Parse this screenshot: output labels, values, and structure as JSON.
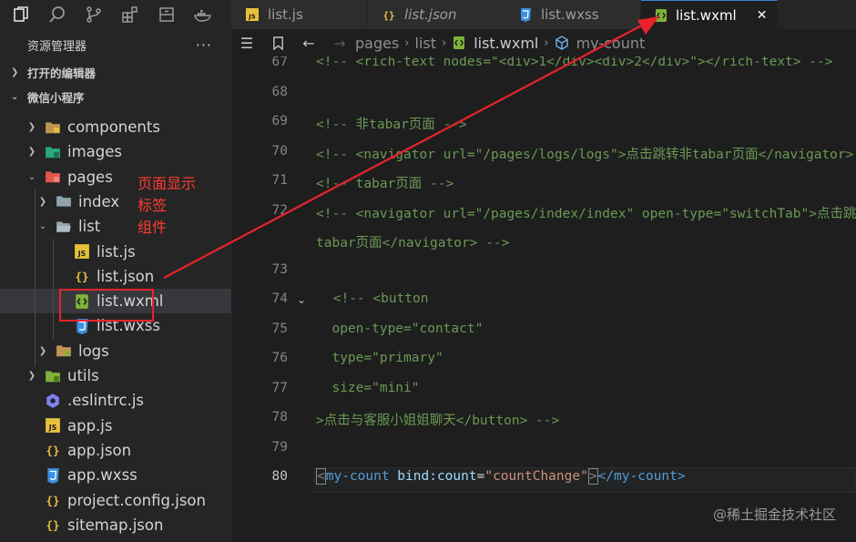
{
  "activity_bar": {
    "icons": [
      "explorer-icon",
      "search-icon",
      "source-control-icon",
      "extensions-icon",
      "storage-icon",
      "docker-icon"
    ]
  },
  "sidebar": {
    "title": "资源管理器",
    "more": "···",
    "sections": [
      {
        "label": "打开的编辑器",
        "expanded": false
      },
      {
        "label": "微信小程序",
        "expanded": true
      }
    ],
    "tree": [
      {
        "label": "components",
        "icon": "components-folder-icon",
        "kind": "folder",
        "chev": "›"
      },
      {
        "label": "images",
        "icon": "images-folder-icon",
        "kind": "folder",
        "chev": "›"
      },
      {
        "label": "pages",
        "icon": "pages-folder-icon",
        "kind": "folder",
        "chev": "⌄"
      },
      {
        "label": "index",
        "icon": "folder-icon",
        "kind": "folder",
        "chev": "›"
      },
      {
        "label": "list",
        "icon": "folder-open-icon",
        "kind": "folder",
        "chev": "⌄"
      },
      {
        "label": "list.js",
        "icon": "js-file-icon",
        "kind": "file"
      },
      {
        "label": "list.json",
        "icon": "json-file-icon",
        "kind": "file"
      },
      {
        "label": "list.wxml",
        "icon": "wxml-file-icon",
        "kind": "file",
        "selected": true
      },
      {
        "label": "list.wxss",
        "icon": "css-file-icon",
        "kind": "file"
      },
      {
        "label": "logs",
        "icon": "logs-folder-icon",
        "kind": "folder",
        "chev": "›"
      },
      {
        "label": "utils",
        "icon": "utils-folder-icon",
        "kind": "folder",
        "chev": "›"
      },
      {
        "label": ".eslintrc.js",
        "icon": "eslint-file-icon",
        "kind": "file"
      },
      {
        "label": "app.js",
        "icon": "js-file-icon",
        "kind": "file"
      },
      {
        "label": "app.json",
        "icon": "json-file-icon",
        "kind": "file"
      },
      {
        "label": "app.wxss",
        "icon": "css-file-icon",
        "kind": "file"
      },
      {
        "label": "project.config.json",
        "icon": "json-file-icon",
        "kind": "file"
      },
      {
        "label": "sitemap.json",
        "icon": "json-file-icon",
        "kind": "file"
      }
    ],
    "annotation": "页面显示标签组件"
  },
  "tabs": [
    {
      "label": "list.js",
      "icon": "js-file-icon",
      "active": false,
      "italic": false
    },
    {
      "label": "list.json",
      "icon": "json-file-icon",
      "active": false,
      "italic": true
    },
    {
      "label": "list.wxss",
      "icon": "css-file-icon",
      "active": false,
      "italic": false
    },
    {
      "label": "list.wxml",
      "icon": "wxml-file-icon",
      "active": true,
      "italic": false,
      "close": "✕"
    }
  ],
  "breadcrumb": {
    "items": [
      "pages",
      "list",
      "list.wxml",
      "my-count"
    ],
    "separator": "›"
  },
  "editor": {
    "lines": [
      {
        "num": "67",
        "text": "<!-- <rich-text nodes=\"<div>1</div><div>2</div>\"></rich-text> -->"
      },
      {
        "num": "68",
        "text": ""
      },
      {
        "num": "69",
        "text": "<!-- 非tabar页面 -->"
      },
      {
        "num": "70",
        "text": "<!-- <navigator url=\"/pages/logs/logs\">点击跳转非tabar页面</navigator> -->"
      },
      {
        "num": "71",
        "text": "<!-- tabar页面 -->"
      },
      {
        "num": "72",
        "text": "<!-- <navigator url=\"/pages/index/index\" open-type=\"switchTab\">点击跳转"
      },
      {
        "num": "",
        "text": "tabar页面</navigator> -->"
      },
      {
        "num": "73",
        "text": ""
      },
      {
        "num": "74",
        "text": " <!-- <button"
      },
      {
        "num": "75",
        "text": "  open-type=\"contact\""
      },
      {
        "num": "76",
        "text": "  type=\"primary\""
      },
      {
        "num": "77",
        "text": "  size=\"mini\""
      },
      {
        "num": "78",
        "text": ">点击与客服小姐姐聊天</button> -->"
      },
      {
        "num": "79",
        "text": ""
      },
      {
        "num": "80",
        "text_parts": {
          "open": "<",
          "tag": "my-count",
          "attr": " bind:count",
          "eq": "=",
          "str": "\"countChange\"",
          "close1": ">",
          "close_tag_open": "</",
          "close_tag": "my-count",
          "close2": ">"
        }
      }
    ]
  },
  "watermark": "@稀土掘金技术社区",
  "colors": {
    "comment": "#6a9955",
    "tag": "#569cd6",
    "attr": "#9cdcfe",
    "string": "#ce9178",
    "annotation_red": "#ff3b30"
  }
}
